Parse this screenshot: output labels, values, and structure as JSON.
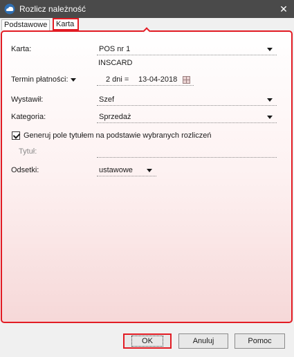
{
  "window": {
    "title": "Rozlicz należność",
    "close_glyph": "✕"
  },
  "tabs": [
    {
      "label": "Podstawowe",
      "active": false
    },
    {
      "label": "Karta",
      "active": true
    }
  ],
  "form": {
    "karta": {
      "label": "Karta:",
      "value": "POS nr 1",
      "sub_value": "INSCARD"
    },
    "termin": {
      "label": "Termin płatności:",
      "days": "2 dni =",
      "date": "13-04-2018"
    },
    "wystawil": {
      "label": "Wystawił:",
      "value": "Szef"
    },
    "kategoria": {
      "label": "Kategoria:",
      "value": "Sprzedaż"
    },
    "generuj": {
      "label": "Generuj pole tytułem na podstawie wybranych rozliczeń",
      "checked": true
    },
    "tytul": {
      "label": "Tytuł:",
      "value": ""
    },
    "odsetki": {
      "label": "Odsetki:",
      "value": "ustawowe"
    }
  },
  "buttons": {
    "ok": "OK",
    "cancel": "Anuluj",
    "help": "Pomoc"
  },
  "colors": {
    "highlight": "#e21b23",
    "titlebar": "#4a4a4a"
  },
  "icons": {
    "app": "cloud-app-icon",
    "calendar": "calendar-icon",
    "dropdown": "chevron-down-icon"
  }
}
